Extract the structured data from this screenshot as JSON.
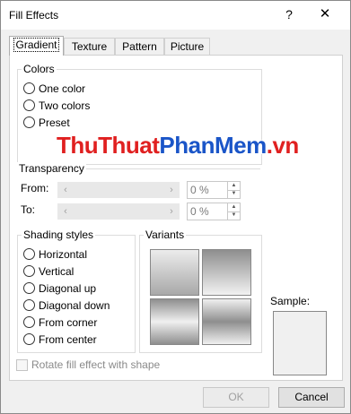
{
  "window": {
    "title": "Fill Effects",
    "help": "?",
    "close": "✕"
  },
  "tabs": [
    "Gradient",
    "Texture",
    "Pattern",
    "Picture"
  ],
  "colors_group": {
    "label": "Colors",
    "options": [
      "One color",
      "Two colors",
      "Preset"
    ]
  },
  "watermark": {
    "part1": "ThuThuat",
    "part2": "PhanMem",
    "part3": ".vn"
  },
  "transparency": {
    "label": "Transparency",
    "from_label": "From:",
    "to_label": "To:",
    "from_value": "0 %",
    "to_value": "0 %"
  },
  "shading_styles": {
    "label": "Shading styles",
    "options": [
      "Horizontal",
      "Vertical",
      "Diagonal up",
      "Diagonal down",
      "From corner",
      "From center"
    ]
  },
  "variants": {
    "label": "Variants"
  },
  "sample": {
    "label": "Sample:"
  },
  "rotate_checkbox": {
    "label": "Rotate fill effect with shape",
    "checked": false
  },
  "buttons": {
    "ok": "OK",
    "cancel": "Cancel"
  },
  "icons": {
    "arrow_left": "‹",
    "arrow_right": "›",
    "spin_up": "▲",
    "spin_down": "▼"
  }
}
